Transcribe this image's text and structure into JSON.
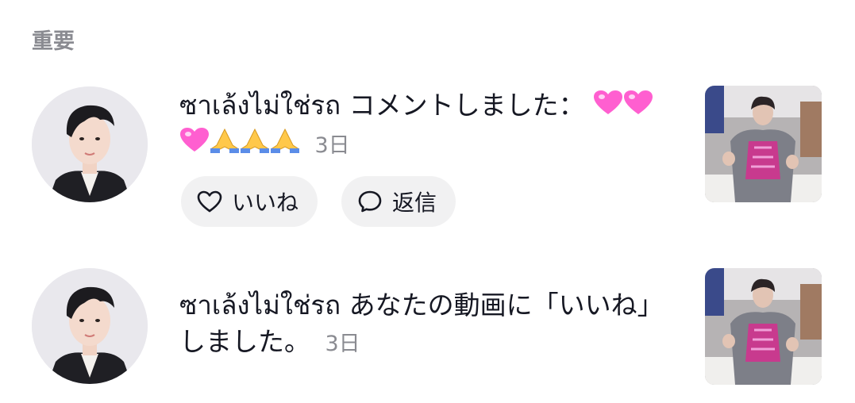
{
  "section": {
    "title": "重要"
  },
  "notifications": [
    {
      "user": "ซาเล้งไม่ใช่รถ",
      "action": "コメントしました：",
      "comment_emojis": [
        "pink-heart-emoji",
        "pink-heart-emoji",
        "pink-heart-emoji",
        "folded-hands-emoji",
        "folded-hands-emoji",
        "folded-hands-emoji"
      ],
      "time": "3日",
      "like_label": "いいね",
      "reply_label": "返信"
    },
    {
      "user": "ซาเล้งไม่ใช่รถ",
      "action": "あなたの動画に「いいね」しました。",
      "time": "3日"
    }
  ],
  "colors": {
    "muted": "#8a8b91",
    "pill_bg": "#f1f1f2",
    "heart": "#ff5fd0"
  }
}
